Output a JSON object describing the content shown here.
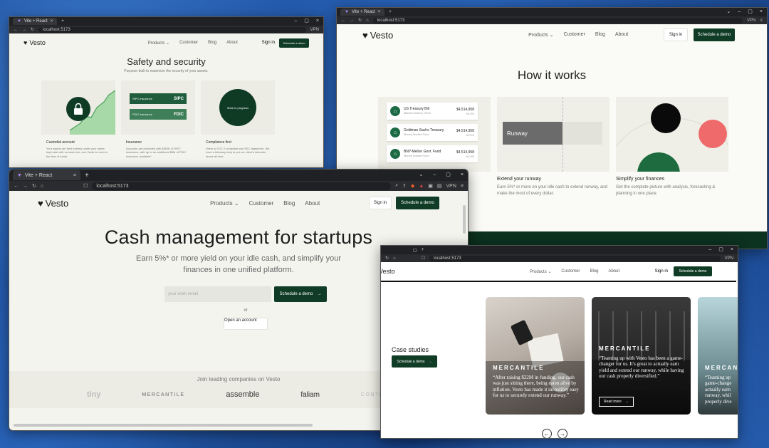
{
  "brand": "Vesto",
  "nav": {
    "products": "Products",
    "customer": "Customer",
    "blog": "Blog",
    "about": "About",
    "signin": "Sign in",
    "demo": "Schedule a demo"
  },
  "browser": {
    "tab_title": "Vite + React",
    "url": "localhost:5173",
    "vpn": "VPN"
  },
  "safety": {
    "title": "Safety and security",
    "subtitle": "Purpose-built to maximize the security of your assets.",
    "badges": {
      "sipc": "SIPC insurance",
      "fdic": "FDIC insurance",
      "sipc_logo": "SIPC",
      "fdic_logo": "FDIC",
      "work": "Work in progress"
    },
    "cards": [
      {
        "title": "Custodial account",
        "text": "Your assets are held entirely under your name, kept safe with no bank risk, and Vesto is never in the flow of funds."
      },
      {
        "title": "Insurance",
        "text": "Accounts are protected with $500K of SIPC insurance, with up to an additional $5M of FDIC insurance available*"
      },
      {
        "title": "Compliance first",
        "text": "Vesto is SOC 2 compliant and SEC registered. We have a fiduciary duty to put our client's interests above all else."
      }
    ]
  },
  "how": {
    "title": "How it works",
    "funds": [
      {
        "name": "US Treasury Bill",
        "sub": "Matures March, 2024",
        "amount": "$4,514,958",
        "pct": "64.5%"
      },
      {
        "name": "Goldman Sachs Treasury",
        "sub": "Money Market Fund",
        "amount": "$4,514,958",
        "pct": "64.5%"
      },
      {
        "name": "BNY-Mellon Govt. Fund",
        "sub": "Money Market Fund",
        "amount": "$4,514,958",
        "pct": "64.5%"
      }
    ],
    "runway_label": "Runway",
    "cols": [
      {
        "title": "Extend your runway",
        "text": "Earn 5%* or more on your idle cash to extend runway, and make the most of every dollar."
      },
      {
        "title": "Simplify your finances",
        "text": "Get the complete picture with analysis, forecasting & planning in one place."
      }
    ]
  },
  "hero": {
    "title": "Cash management for startups",
    "lead": "Earn 5%* or more yield on your idle cash, and simplify your finances in one unified platform.",
    "email_placeholder": "your work email",
    "cta": "Schedule a demo",
    "or": "or",
    "open": "Open an account",
    "join": "Join leading companies on Vesto",
    "logos": [
      "tiny",
      "MERCANTILE",
      "assemble",
      "faliam",
      "CONTRARY"
    ]
  },
  "cases": {
    "title": "Case studies",
    "cta": "Schedule a demo",
    "items": [
      {
        "brand": "MERCANTILE",
        "quote": "“After raising $22M in funding, our cash was just sitting there, being eaten alive by inflation. Vesto has made it incredibly easy for us to securely extend our runway.”"
      },
      {
        "brand": "MERCANTILE",
        "quote": "“Teaming up with Vesto has been a game-changer for us. It's great to actually earn yield and extend our runway, while having our cash properly diversified.”",
        "more": "Read more"
      },
      {
        "brand": "MERCAN",
        "quote": "“Teaming up game-change actually earn runway, whil properly dive"
      }
    ]
  }
}
